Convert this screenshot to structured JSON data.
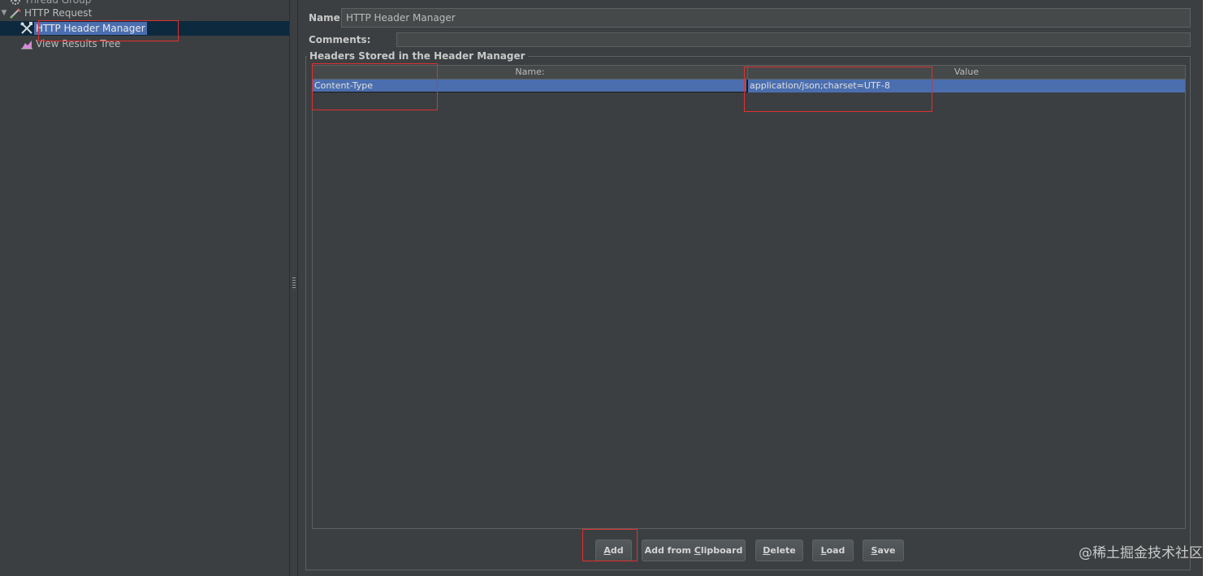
{
  "tree": {
    "thread_group_label": "Thread Group",
    "http_request_label": "HTTP Request",
    "header_manager_label": "HTTP Header Manager",
    "results_tree_label": "View Results Tree"
  },
  "config": {
    "name_label": "Name:",
    "name_value": "HTTP Header Manager",
    "comments_label": "Comments:",
    "group_title": "Headers Stored in the Header Manager"
  },
  "table": {
    "columns": [
      "Name:",
      "Value"
    ],
    "rows": [
      {
        "name": "Content-Type",
        "value": "application/json;charset=UTF-8"
      }
    ]
  },
  "buttons": {
    "add": {
      "pre": "",
      "u": "A",
      "post": "dd"
    },
    "clipboard": {
      "pre": "Add from ",
      "u": "C",
      "post": "lipboard"
    },
    "delete": {
      "pre": "",
      "u": "D",
      "post": "elete"
    },
    "load": {
      "pre": "",
      "u": "L",
      "post": "oad"
    },
    "save": {
      "pre": "",
      "u": "S",
      "post": "ave"
    }
  },
  "watermark": "@稀土掘金技术社区",
  "colors": {
    "selection": "#4b6eaf",
    "annotation": "#e03030",
    "panel_bg": "#3c3f41"
  }
}
